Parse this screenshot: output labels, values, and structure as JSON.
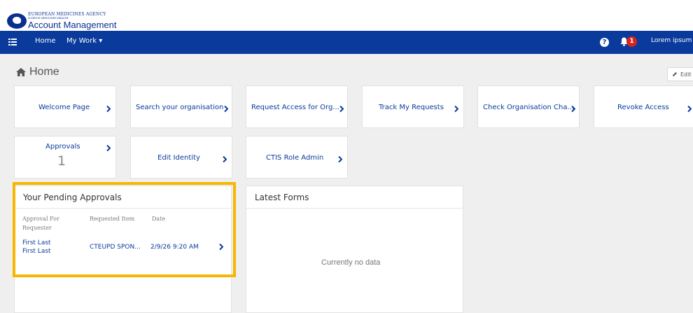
{
  "header": {
    "agency_name": "EUROPEAN MEDICINES AGENCY",
    "agency_subtitle": "SCIENCE  MEDICINES  HEALTH",
    "app_title": "Account Management"
  },
  "nav": {
    "home_label": "Home",
    "my_work_label": "My Work ▾",
    "notification_count": "1",
    "user_name": "Lorem ipsum"
  },
  "page": {
    "title": "Home",
    "edit_label": "Edit"
  },
  "tiles": [
    {
      "label": "Welcome Page"
    },
    {
      "label": "Search your organisation"
    },
    {
      "label": "Request Access for Org..."
    },
    {
      "label": "Track My Requests"
    },
    {
      "label": "Check Organisation Cha..."
    },
    {
      "label": "Revoke Access"
    },
    {
      "label": "Approvals",
      "count": "1"
    },
    {
      "label": "Edit Identity"
    },
    {
      "label": "CTIS Role Admin"
    }
  ],
  "pending": {
    "title": "Your Pending Approvals",
    "columns": [
      "Approval For Requester",
      "Requested Item",
      "Date"
    ],
    "rows": [
      {
        "approval_for": "First Last",
        "requester": "First Last",
        "item": "CTEUPD SPON...",
        "date": "2/9/26 9:20 AM"
      }
    ]
  },
  "latest_forms": {
    "title": "Latest Forms",
    "empty_text": "Currently no data"
  },
  "colors": {
    "brand_blue": "#0a3a9c",
    "highlight": "#f7b600",
    "badge_red": "#d9231d"
  }
}
